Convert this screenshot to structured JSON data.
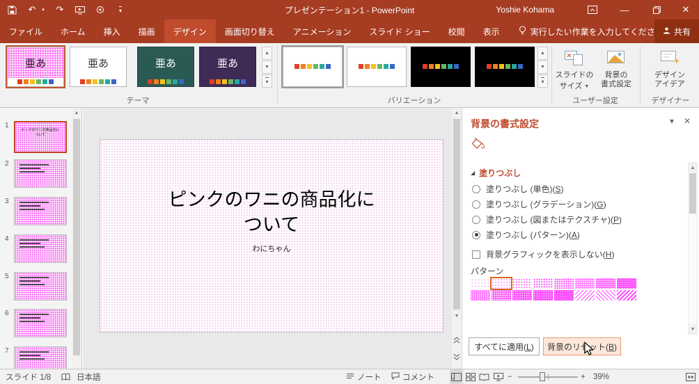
{
  "colors": {
    "titlebar": "#a63c22",
    "tab_active": "#c04b2d",
    "share_bg": "#8e2f12",
    "ribbon_bg": "#f1f1f1",
    "accent": "#bf4a2e",
    "selection_border": "#c0431f",
    "pattern_magenta": "#ff4dff",
    "canvas_bg": "#e9e9e9"
  },
  "titlebar": {
    "title": "プレゼンテーション1 - PowerPoint",
    "user": "Yoshie Kohama"
  },
  "tabs": [
    {
      "label": "ファイル"
    },
    {
      "label": "ホーム"
    },
    {
      "label": "挿入"
    },
    {
      "label": "描画"
    },
    {
      "label": "デザイン"
    },
    {
      "label": "画面切り替え"
    },
    {
      "label": "アニメーション"
    },
    {
      "label": "スライド ショー"
    },
    {
      "label": "校閲"
    },
    {
      "label": "表示"
    }
  ],
  "tellme": "実行したい作業を入力してください",
  "share": "共有",
  "ribbon": {
    "theme_glyph": "亜あ",
    "groups": {
      "themes": "テーマ",
      "variants": "バリエーション",
      "custom": "ユーザー設定",
      "designer": "デザイナー"
    },
    "slide_size_1": "スライドの",
    "slide_size_2": "サイズ",
    "format_background": "背景の\n書式設定",
    "design_ideas": "デザイン\nアイデア",
    "palette": [
      "#e2401f",
      "#ef8121",
      "#f2c21c",
      "#69b764",
      "#2aa8a0",
      "#3a66c6"
    ]
  },
  "slides": [
    {
      "n": "1"
    },
    {
      "n": "2"
    },
    {
      "n": "3"
    },
    {
      "n": "4"
    },
    {
      "n": "5"
    },
    {
      "n": "6"
    },
    {
      "n": "7"
    }
  ],
  "slide": {
    "title": "ピンクのワニの商品化に\nついて",
    "subtitle": "わにちゃん"
  },
  "pane": {
    "title": "背景の書式設定",
    "section": "塗りつぶし",
    "radios": [
      {
        "pre": "塗りつぶし (単色)(",
        "key": "S",
        "suf": ")"
      },
      {
        "pre": "塗りつぶし (グラデーション)(",
        "key": "G",
        "suf": ")"
      },
      {
        "pre": "塗りつぶし (図またはテクスチャ)(",
        "key": "P",
        "suf": ")"
      },
      {
        "pre": "塗りつぶし (パターン)(",
        "key": "A",
        "suf": ")"
      }
    ],
    "selected_radio_index": 3,
    "checkbox": {
      "pre": "背景グラフィックを表示しない(",
      "key": "H",
      "suf": ")",
      "checked": false
    },
    "pattern_label": "パターン",
    "selected_pattern_index": 1,
    "apply_all": {
      "pre": "すべてに適用(",
      "key": "L",
      "suf": ")"
    },
    "reset": {
      "pre": "背景のリセット(",
      "key": "B",
      "suf": ")"
    }
  },
  "statusbar": {
    "slide_count": "スライド 1/8",
    "language": "日本語",
    "notes": "ノート",
    "comments": "コメント",
    "zoom": "39%"
  }
}
